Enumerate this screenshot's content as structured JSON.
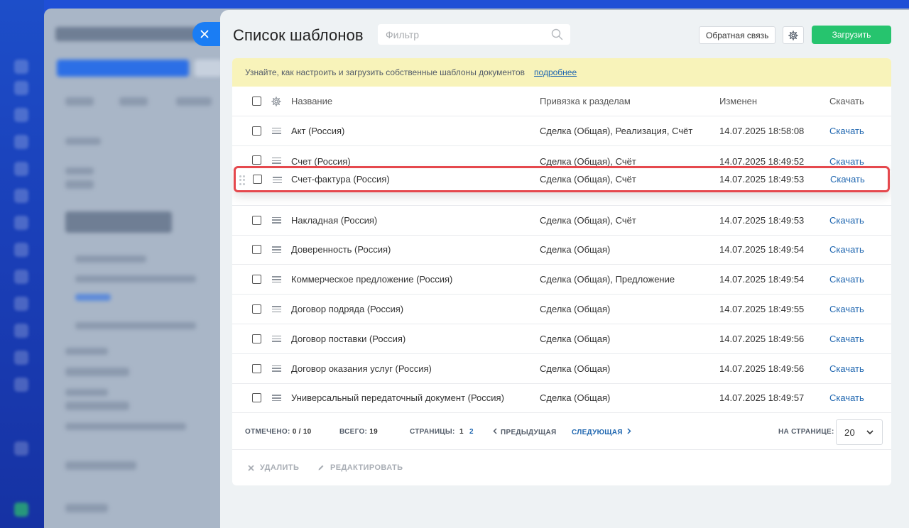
{
  "panel": {
    "title": "Список шаблонов",
    "filter_placeholder": "Фильтр",
    "feedback_label": "Обратная связь",
    "upload_label": "Загрузить"
  },
  "notice": {
    "text": "Узнайте, как настроить и загрузить собственные шаблоны документов",
    "link": "подробнее"
  },
  "table": {
    "columns": [
      "Название",
      "Привязка к разделам",
      "Изменен",
      "Скачать"
    ],
    "rows": [
      {
        "name": "Акт (Россия)",
        "binding": "Сделка (Общая), Реализация, Счёт",
        "modified": "14.07.2025 18:58:08",
        "download": "Скачать"
      },
      {
        "name": "Счет (Россия)",
        "binding": "Сделка (Общая), Счёт",
        "modified": "14.07.2025 18:49:52",
        "download": "Скачать"
      },
      {
        "name": "Счет-фактура (Россия)",
        "binding": "Сделка (Общая), Счёт",
        "modified": "14.07.2025 18:49:53",
        "download": "Скачать"
      },
      {
        "name": "Накладная (Россия)",
        "binding": "Сделка (Общая), Счёт",
        "modified": "14.07.2025 18:49:53",
        "download": "Скачать"
      },
      {
        "name": "Доверенность (Россия)",
        "binding": "Сделка (Общая)",
        "modified": "14.07.2025 18:49:54",
        "download": "Скачать"
      },
      {
        "name": "Коммерческое предложение (Россия)",
        "binding": "Сделка (Общая), Предложение",
        "modified": "14.07.2025 18:49:54",
        "download": "Скачать"
      },
      {
        "name": "Договор подряда (Россия)",
        "binding": "Сделка (Общая)",
        "modified": "14.07.2025 18:49:55",
        "download": "Скачать"
      },
      {
        "name": "Договор поставки (Россия)",
        "binding": "Сделка (Общая)",
        "modified": "14.07.2025 18:49:56",
        "download": "Скачать"
      },
      {
        "name": "Договор оказания услуг (Россия)",
        "binding": "Сделка (Общая)",
        "modified": "14.07.2025 18:49:56",
        "download": "Скачать"
      },
      {
        "name": "Универсальный передаточный документ (Россия)",
        "binding": "Сделка (Общая)",
        "modified": "14.07.2025 18:49:57",
        "download": "Скачать"
      }
    ]
  },
  "pager": {
    "checked_label": "ОТМЕЧЕНО:",
    "checked_value": "0 / 10",
    "total_label": "ВСЕГО:",
    "total_value": "19",
    "pages_label": "СТРАНИЦЫ:",
    "pages": [
      "1",
      "2"
    ],
    "prev_label": "ПРЕДЫДУЩАЯ",
    "next_label": "СЛЕДУЮЩАЯ",
    "per_page_label": "НА СТРАНИЦЕ:",
    "per_page_value": "20"
  },
  "actions": {
    "delete_label": "УДАЛИТЬ",
    "edit_label": "РЕДАКТИРОВАТЬ"
  },
  "colors": {
    "accent_green": "#26c46e",
    "link_blue": "#2067b0",
    "highlight_red": "#e5484d",
    "notice_yellow": "#f8f3ba"
  }
}
